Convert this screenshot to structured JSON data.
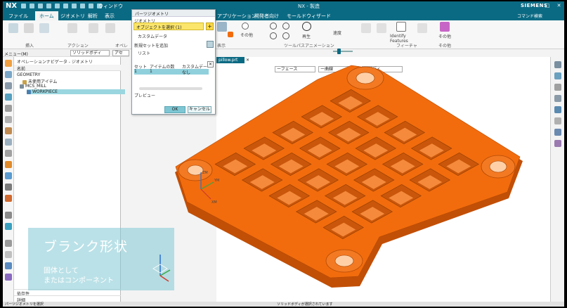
{
  "app": {
    "logo": "NX",
    "window_menu": "ウィンドウ",
    "title": "NX - 製造",
    "brand": "SIEMENS",
    "window_controls": "– □ ✕"
  },
  "tabs": [
    {
      "label": "ファイル"
    },
    {
      "label": "ホーム",
      "active": true
    },
    {
      "label": "ジオメトリ"
    },
    {
      "label": "解析"
    },
    {
      "label": "表示"
    },
    {
      "label": "アプリケーション"
    },
    {
      "label": "開発者向け"
    },
    {
      "label": "モールドウィザード"
    }
  ],
  "search_label": "コマンド検索",
  "ribbon": {
    "groups": {
      "insert": "挿入",
      "actions": "アクション",
      "operation": "オペレ",
      "display": "表示",
      "toolpath_animation": "ツールパスアニメーション",
      "feature": "フィーチャ",
      "other": "その他"
    },
    "labels": {
      "other1": "その他",
      "play": "再生",
      "speed": "速度",
      "identify_features": "Identify Features",
      "other2": "その他"
    }
  },
  "filterbar": {
    "menu": "メニュー(M)",
    "filter": "ソリッドボディ",
    "selector": "アセ"
  },
  "navigator": {
    "title": "オペレーションナビゲータ - ジオメトリ",
    "column": "名前",
    "items": [
      {
        "label": "GEOMETRY"
      },
      {
        "label": "未使用アイテム"
      },
      {
        "label": "MCS_MILL"
      },
      {
        "label": "WORKPIECE",
        "selected": true
      }
    ],
    "bottom": [
      "依存性",
      "詳細"
    ]
  },
  "dialog": {
    "title": "パーツジオメトリ",
    "section_geometry": "ジオメトリ",
    "select_object": "オブジェクトを選択 (1)",
    "custom_data": "カスタムデータ",
    "add_new_set": "新規セットを追加",
    "list_label": "リスト",
    "table": {
      "headers": [
        "セット",
        "アイテムの数",
        "カスタムデー"
      ],
      "rows": [
        [
          "1",
          "1",
          "なし"
        ]
      ]
    },
    "preview": "プレビュー",
    "ok": "OK",
    "cancel": "キャンセル"
  },
  "graphics": {
    "tab": "pillow.prt",
    "filters": [
      "ーフェース",
      "ー曲線",
      "ーボディ"
    ],
    "triad_axes": [
      "ZM",
      "YM",
      "XM"
    ]
  },
  "overlay": {
    "title": "ブランク形状",
    "line1": "固体として",
    "line2": "またはコンポーネント"
  },
  "status": {
    "left": "パーツジオメトリを選択",
    "mid": "ソリッドボディが選択されています"
  },
  "colors": {
    "titlebar": "#0b6a83",
    "accent": "#7ec6d3",
    "part_orange": "#f26c0d",
    "select_yellow": "#fbe56b"
  }
}
